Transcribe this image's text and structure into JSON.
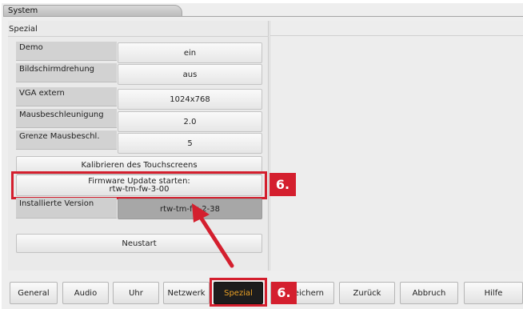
{
  "window": {
    "title": "System"
  },
  "section": {
    "title": "Spezial"
  },
  "rows": [
    {
      "label": "Demo",
      "value": "ein"
    },
    {
      "label": "Bildschirmdrehung",
      "value": "aus"
    },
    {
      "label": "VGA extern",
      "value": "1024x768"
    },
    {
      "label": "Mausbeschleunigung",
      "value": "2.0"
    },
    {
      "label": "Grenze Mausbeschl.",
      "value": "5"
    }
  ],
  "calibrate_label": "Kalibrieren des Touchscreens",
  "firmware": {
    "line1": "Firmware Update starten:",
    "line2": "rtw-tm-fw-3-00"
  },
  "installed": {
    "label": "Installierte Version",
    "value": "rtw-tm-fw-2-38"
  },
  "restart_label": "Neustart",
  "callout_label": "6.",
  "tabs": {
    "general": "General",
    "audio": "Audio",
    "uhr": "Uhr",
    "netzwerk": "Netzwerk",
    "spezial": "Spezial",
    "speichern": "Speichern",
    "zurueck": "Zurück",
    "abbruch": "Abbruch",
    "hilfe": "Hilfe"
  },
  "colors": {
    "highlight": "#d41f2e",
    "active_tab_text": "#e8a025",
    "active_tab_bg": "#1d1d1d"
  }
}
